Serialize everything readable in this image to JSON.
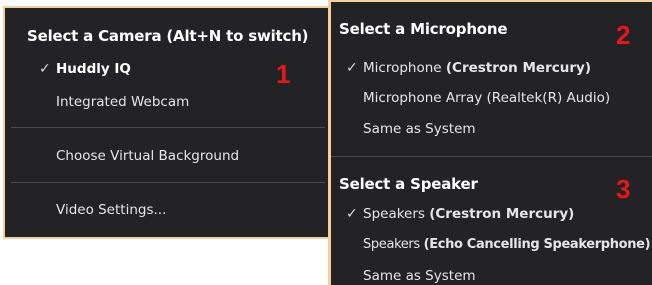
{
  "camera_menu": {
    "heading": "Select a Camera (Alt+N to switch)",
    "items": [
      {
        "label": "Huddly IQ",
        "selected": true
      },
      {
        "label": "Integrated Webcam",
        "selected": false
      }
    ],
    "virtual_background": "Choose Virtual Background",
    "video_settings": "Video Settings...",
    "badge": "1"
  },
  "microphone_menu": {
    "heading": "Select a Microphone",
    "items": [
      {
        "label": "Microphone ",
        "detail": "(Crestron Mercury)",
        "selected": true
      },
      {
        "label": "Microphone Array (Realtek(R) Audio)",
        "selected": false
      },
      {
        "label": "Same as System",
        "selected": false
      }
    ],
    "badge": "2"
  },
  "speaker_menu": {
    "heading": "Select a Speaker",
    "items": [
      {
        "label": "Speakers ",
        "detail": "(Crestron Mercury)",
        "selected": true
      },
      {
        "label": "Speakers ",
        "detail": "(Echo Cancelling Speakerphone)",
        "selected": false
      },
      {
        "label": "Same as System",
        "selected": false
      }
    ],
    "badge": "3"
  },
  "check_glyph": "✓",
  "colors": {
    "menu_bg": "#232325",
    "highlight_border": "#f4d19a",
    "badge_red": "#e8171b"
  }
}
